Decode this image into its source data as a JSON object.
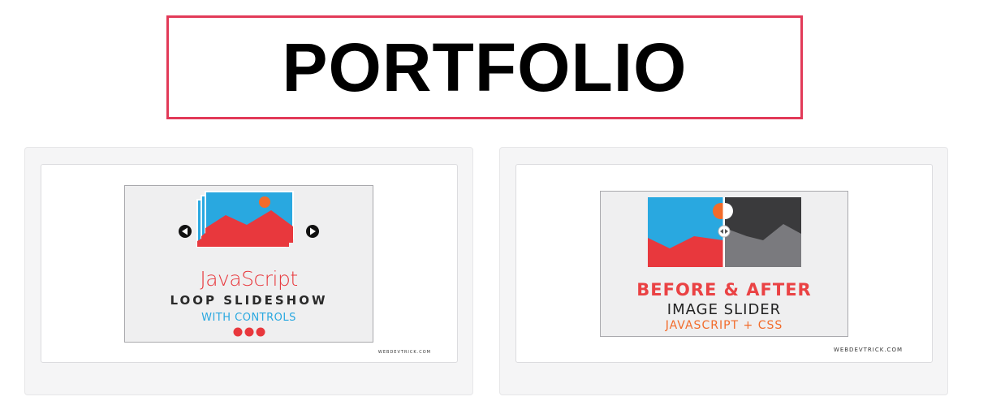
{
  "page": {
    "title": "PORTFOLIO"
  },
  "portfolio": {
    "items": [
      {
        "title": "JavaScript",
        "line2": "LOOP SLIDESHOW",
        "line3": "WITH CONTROLS",
        "brand": "WEBDEVTRICK.COM"
      },
      {
        "title": "BEFORE & AFTER",
        "line2": "IMAGE SLIDER",
        "line3": "JAVASCRIPT + CSS",
        "brand": "WEBDEVTRICK.COM"
      }
    ]
  },
  "colors": {
    "title_border": "#e23a58",
    "red": "#e8383d",
    "blue": "#29a8e0",
    "orange": "#f26b2a",
    "card_bg": "#f5f5f6"
  },
  "icons": [
    "prev-arrow-icon",
    "next-arrow-icon",
    "image-stack-icon",
    "slider-dots-icon",
    "compare-handle-icon"
  ]
}
